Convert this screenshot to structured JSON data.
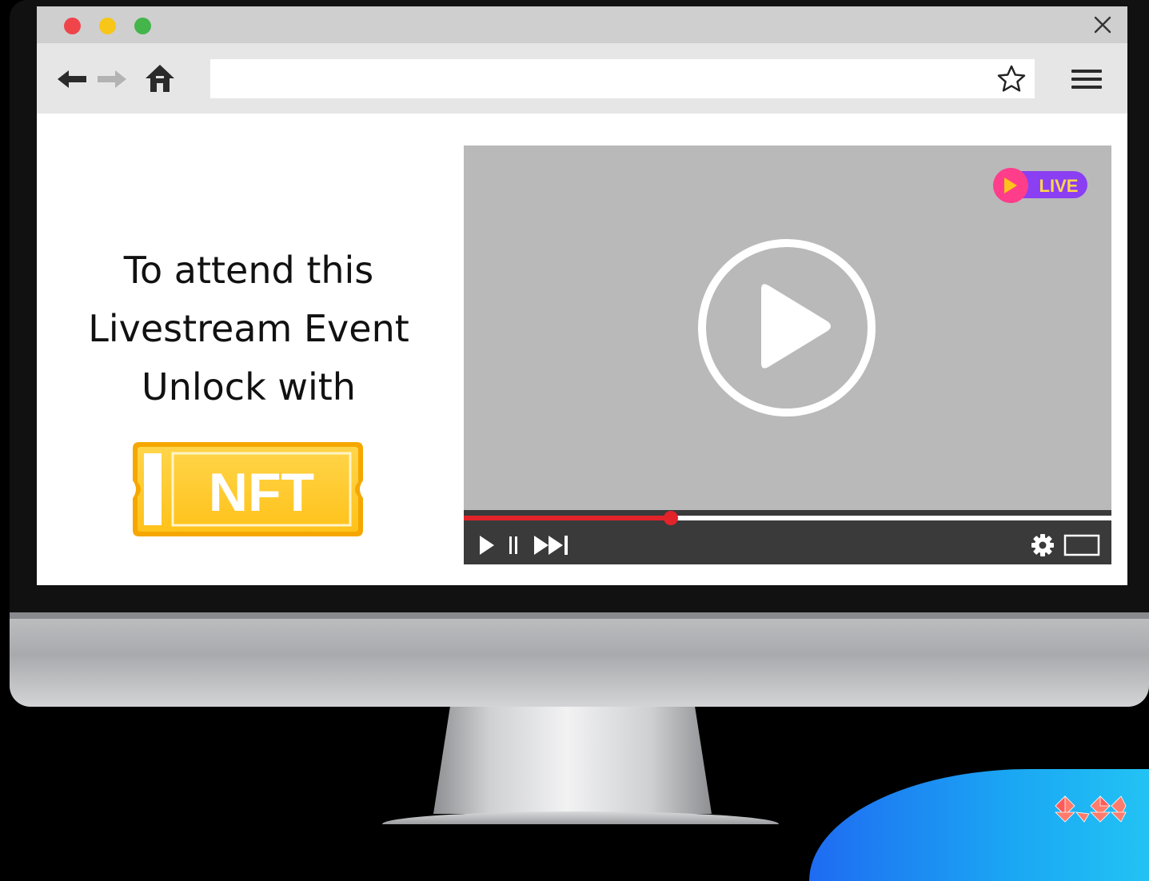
{
  "browser": {
    "window_controls": [
      "close",
      "minimize",
      "maximize"
    ],
    "address_bar": {
      "value": "",
      "placeholder": ""
    },
    "icons": [
      "back-arrow-icon",
      "forward-arrow-icon",
      "home-icon",
      "star-icon",
      "hamburger-menu-icon",
      "close-icon"
    ]
  },
  "page": {
    "headline_lines": [
      "To attend this",
      "Livestream Event",
      "Unlock with"
    ],
    "ticket_label": "NFT"
  },
  "video": {
    "live_badge": "LIVE",
    "progress": 0.32,
    "controls": [
      "play-icon",
      "pause-icon",
      "skip-next-icon",
      "settings-gear-icon",
      "fullscreen-icon"
    ]
  },
  "colors": {
    "traffic_red": "#f0444b",
    "traffic_yellow": "#f7c619",
    "traffic_green": "#43b54a",
    "progress_red": "#e3232a",
    "ticket_yellow": "#ffcc33",
    "live_purple": "#8a3ff2",
    "live_pink": "#ff3d8b",
    "accent_blue": "#1a8ff2"
  }
}
